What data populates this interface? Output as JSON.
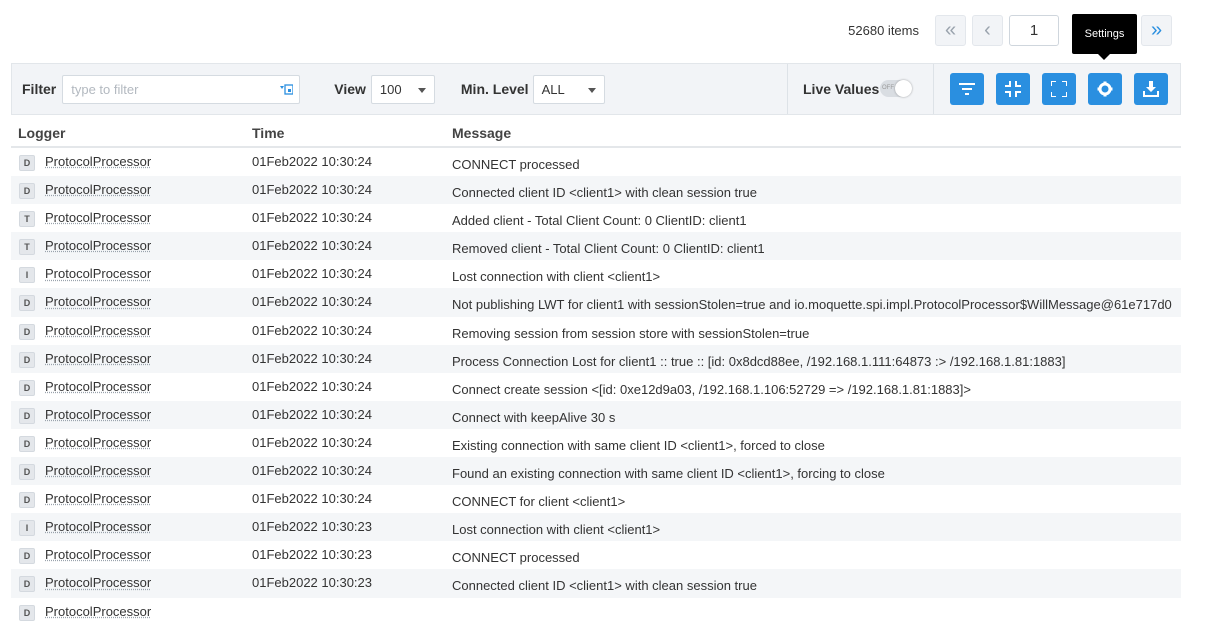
{
  "pagination": {
    "items_count": "52680 items",
    "first": "«",
    "prev": "‹",
    "page": "1",
    "last": "»"
  },
  "tooltip": {
    "text": "Settings"
  },
  "toolbar": {
    "filter_label": "Filter",
    "filter_placeholder": "type to filter",
    "view_label": "View",
    "view_value": "100",
    "level_label": "Min. Level",
    "level_value": "ALL",
    "live_label": "Live Values",
    "toggle_state": "OFF"
  },
  "columns": {
    "logger": "Logger",
    "time": "Time",
    "message": "Message"
  },
  "rows": [
    {
      "level": "D",
      "logger": "ProtocolProcessor",
      "time": "01Feb2022 10:30:24",
      "message": "CONNECT processed"
    },
    {
      "level": "D",
      "logger": "ProtocolProcessor",
      "time": "01Feb2022 10:30:24",
      "message": "Connected client ID <client1> with clean session true"
    },
    {
      "level": "T",
      "logger": "ProtocolProcessor",
      "time": "01Feb2022 10:30:24",
      "message": "Added client - Total Client Count: 0 ClientID: client1"
    },
    {
      "level": "T",
      "logger": "ProtocolProcessor",
      "time": "01Feb2022 10:30:24",
      "message": "Removed client - Total Client Count: 0 ClientID: client1"
    },
    {
      "level": "I",
      "logger": "ProtocolProcessor",
      "time": "01Feb2022 10:30:24",
      "message": "Lost connection with client <client1>"
    },
    {
      "level": "D",
      "logger": "ProtocolProcessor",
      "time": "01Feb2022 10:30:24",
      "message": "Not publishing LWT for client1 with sessionStolen=true and io.moquette.spi.impl.ProtocolProcessor$WillMessage@61e717d0"
    },
    {
      "level": "D",
      "logger": "ProtocolProcessor",
      "time": "01Feb2022 10:30:24",
      "message": "Removing session from session store with sessionStolen=true"
    },
    {
      "level": "D",
      "logger": "ProtocolProcessor",
      "time": "01Feb2022 10:30:24",
      "message": "Process Connection Lost for client1 :: true :: [id: 0x8dcd88ee, /192.168.1.111:64873 :> /192.168.1.81:1883]"
    },
    {
      "level": "D",
      "logger": "ProtocolProcessor",
      "time": "01Feb2022 10:30:24",
      "message": "Connect create session <[id: 0xe12d9a03, /192.168.1.106:52729 => /192.168.1.81:1883]>"
    },
    {
      "level": "D",
      "logger": "ProtocolProcessor",
      "time": "01Feb2022 10:30:24",
      "message": "Connect with keepAlive 30 s"
    },
    {
      "level": "D",
      "logger": "ProtocolProcessor",
      "time": "01Feb2022 10:30:24",
      "message": "Existing connection with same client ID <client1>, forced to close"
    },
    {
      "level": "D",
      "logger": "ProtocolProcessor",
      "time": "01Feb2022 10:30:24",
      "message": "Found an existing connection with same client ID <client1>, forcing to close"
    },
    {
      "level": "D",
      "logger": "ProtocolProcessor",
      "time": "01Feb2022 10:30:24",
      "message": "CONNECT for client <client1>"
    },
    {
      "level": "I",
      "logger": "ProtocolProcessor",
      "time": "01Feb2022 10:30:23",
      "message": "Lost connection with client <client1>"
    },
    {
      "level": "D",
      "logger": "ProtocolProcessor",
      "time": "01Feb2022 10:30:23",
      "message": "CONNECT processed"
    },
    {
      "level": "D",
      "logger": "ProtocolProcessor",
      "time": "01Feb2022 10:30:23",
      "message": "Connected client ID <client1> with clean session true"
    },
    {
      "level": "D",
      "logger": "ProtocolProcessor",
      "time": "",
      "message": ""
    }
  ],
  "colors": {
    "accent": "#2a8fe0",
    "toolbar_bg": "#f2f4f7",
    "row_alt": "#f4f6f8"
  }
}
